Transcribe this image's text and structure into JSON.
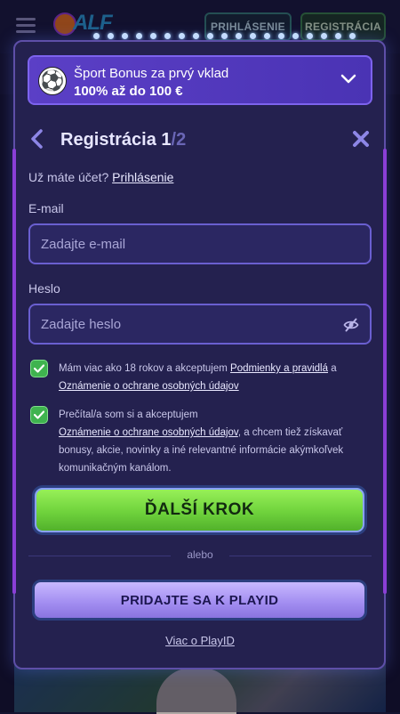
{
  "header": {
    "logo_text": "ALF",
    "login_label": "PRIHLÁSENIE",
    "register_label": "REGISTRÁCIA"
  },
  "bonus": {
    "title": "Šport Bonus za prvý vklad",
    "subtitle": "100% až do 100 €"
  },
  "registration": {
    "title": "Registrácia",
    "step_current": "1",
    "step_total": "/2",
    "have_account_text": "Už máte účet?",
    "login_link": "Prihlásenie",
    "email_label": "E-mail",
    "email_placeholder": "Zadajte e-mail",
    "password_label": "Heslo",
    "password_placeholder": "Zadajte heslo",
    "terms": {
      "text_1": "Mám viac ako 18 rokov a akceptujem",
      "link_1": "Podmienky a pravidlá",
      "text_2": "a",
      "link_2": "Oznámenie o ochrane osobných údajov"
    },
    "marketing": {
      "text_1": "Prečítal/a som si a akceptujem",
      "link": "Oznámenie o ochrane osobných údajov",
      "text_2": ", a chcem tiež získavať bonusy, akcie, novinky a iné relevantné informácie akýmkoľvek komunikačným kanálom."
    },
    "next_button": "ĎALŠÍ KROK",
    "or_text": "alebo",
    "playid_button": "PRIDAJTE SA K PLAYID",
    "playid_more": "Viac o PlayID"
  },
  "colors": {
    "modal_bg": "#24214f",
    "accent_purple": "#5b3fc6",
    "next_green": "#6fd23c",
    "playid_lavender": "#a18cf0",
    "check_green": "#3fb34f"
  },
  "icons": {
    "menu": "hamburger-icon",
    "bonus": "soccer-ball-icon",
    "expand": "chevron-down-icon",
    "back": "chevron-left-icon",
    "close": "close-icon",
    "password_toggle": "eye-off-icon",
    "checkbox": "checkmark-icon"
  }
}
